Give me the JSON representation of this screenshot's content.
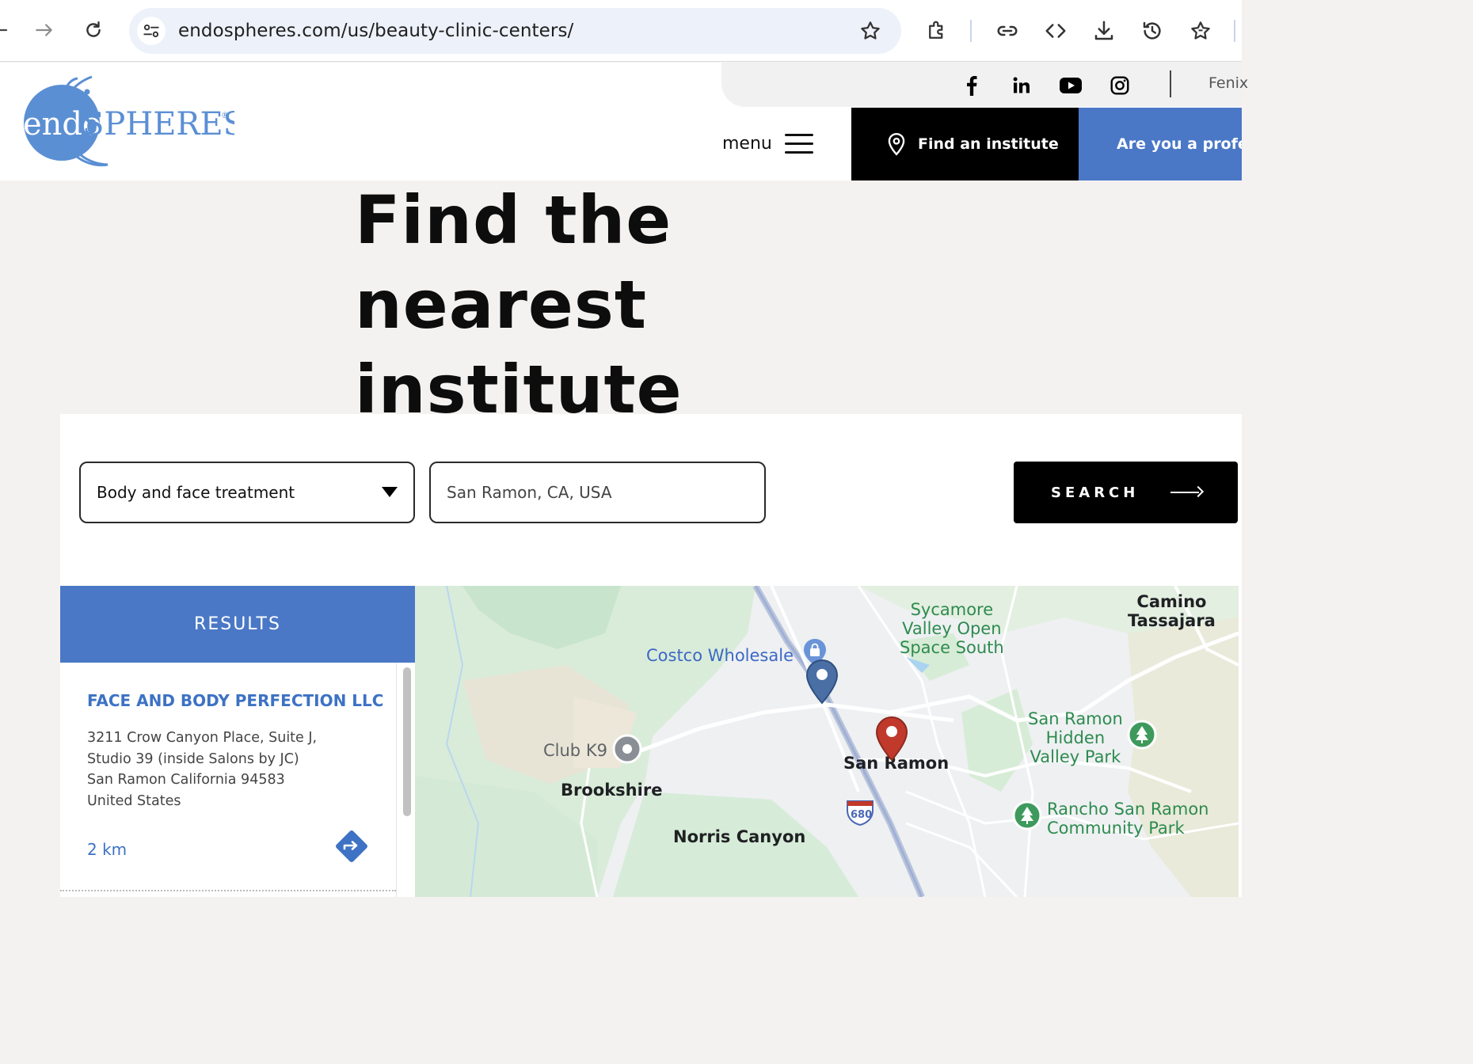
{
  "browser": {
    "url": "endospheres.com/us/beauty-clinic-centers/"
  },
  "header": {
    "logo_text_a": "endo",
    "logo_text_b": "SPHERES",
    "logo_mark": "®",
    "language_label": "Fenix",
    "menu_label": "menu",
    "find_institute_label": "Find an institute",
    "professional_label": "Are you a profess"
  },
  "hero": {
    "title_line1": "Find the nearest",
    "title_line2": "institute"
  },
  "search": {
    "treatment_selected": "Body and face treatment",
    "location_value": "San Ramon, CA, USA",
    "button_label": "SEARCH"
  },
  "results": {
    "header": "RESULTS",
    "items": [
      {
        "name": "FACE AND BODY PERFECTION LLC",
        "address_lines": [
          "3211 Crow Canyon Place, Suite J,",
          "Studio 39 (inside Salons by JC)",
          "San Ramon California 94583",
          "United States"
        ],
        "distance": "2 km"
      }
    ]
  },
  "map": {
    "labels": {
      "costco": "Costco Wholesale",
      "sycamore_1": "Sycamore",
      "sycamore_2": "Valley Open",
      "sycamore_3": "Space South",
      "camino_1": "Camino",
      "camino_2": "Tassajara",
      "club_k9": "Club K9",
      "brookshire": "Brookshire",
      "san_ramon": "San Ramon",
      "hidden_1": "San Ramon",
      "hidden_2": "Hidden",
      "hidden_3": "Valley Park",
      "rancho_1": "Rancho San Ramon",
      "rancho_2": "Community Park",
      "norris": "Norris Canyon",
      "highway": "680"
    }
  },
  "colors": {
    "brand_blue": "#4a78c6",
    "link_blue": "#3d72c4",
    "marker_red": "#c0392b",
    "marker_blue": "#4a6fa5"
  }
}
